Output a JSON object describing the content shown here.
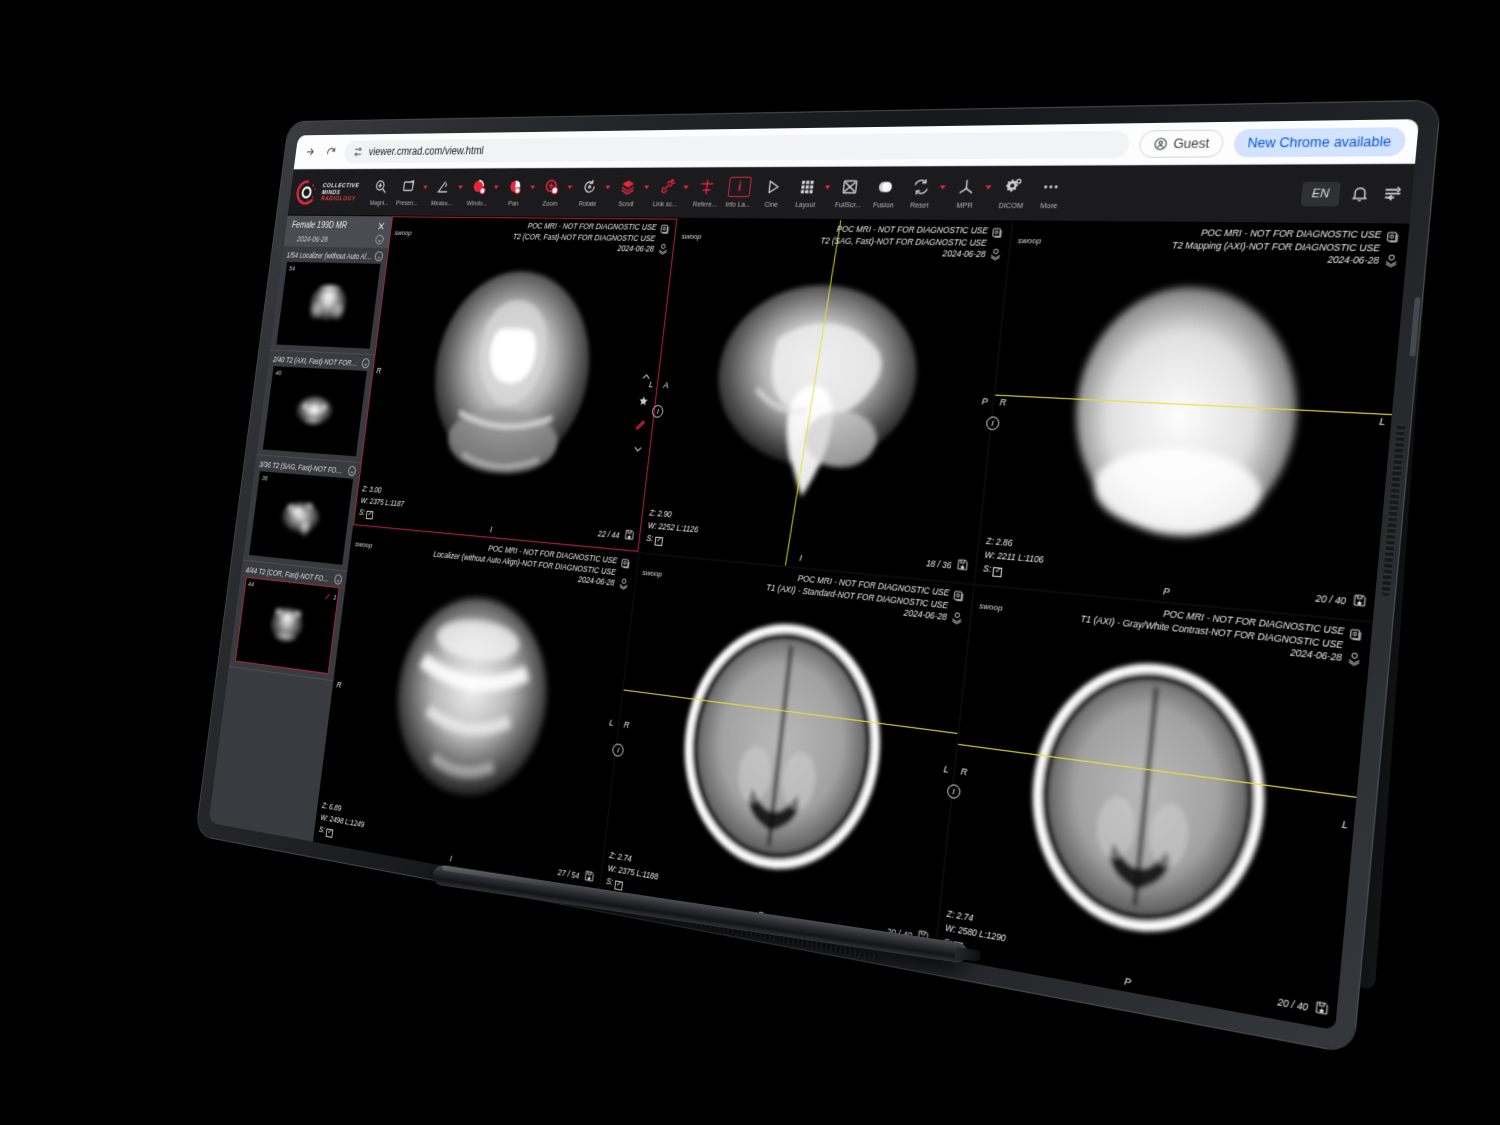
{
  "browser": {
    "url": "viewer.cmrad.com/view.html",
    "guest_label": "Guest",
    "update_banner": "New Chrome available",
    "forward_icon": "forward-arrow-icon",
    "reload_icon": "reload-icon",
    "tune_icon": "site-settings-icon"
  },
  "brand": {
    "line1": "COLLECTIVE",
    "line2": "MINDS",
    "line3": "RADIOLOGY"
  },
  "toolbar": {
    "tools": [
      {
        "label": "Magni...",
        "icon": "magnify-icon",
        "accent": false,
        "caret": false,
        "boxed": false
      },
      {
        "label": "Presen...",
        "icon": "presentation-icon",
        "accent": false,
        "caret": true,
        "boxed": false
      },
      {
        "label": "Measu...",
        "icon": "measure-angle-icon",
        "accent": false,
        "caret": true,
        "boxed": false
      },
      {
        "label": "Windo...",
        "icon": "window-level-icon",
        "accent": true,
        "caret": true,
        "boxed": false
      },
      {
        "label": "Pan",
        "icon": "pan-icon",
        "accent": true,
        "caret": true,
        "boxed": false
      },
      {
        "label": "Zoom",
        "icon": "zoom-icon",
        "accent": true,
        "caret": true,
        "boxed": false
      },
      {
        "label": "Rotate",
        "icon": "rotate-icon",
        "accent": false,
        "caret": true,
        "boxed": false
      },
      {
        "label": "Scroll",
        "icon": "scroll-stack-icon",
        "accent": true,
        "caret": true,
        "boxed": false
      },
      {
        "label": "Link sc...",
        "icon": "link-scroll-icon",
        "accent": true,
        "caret": true,
        "boxed": false
      },
      {
        "label": "Refere...",
        "icon": "reference-lines-icon",
        "accent": true,
        "caret": false,
        "boxed": false
      },
      {
        "label": "Info La...",
        "icon": "info-layer-icon",
        "accent": true,
        "caret": false,
        "boxed": true
      },
      {
        "label": "Cine",
        "icon": "play-cine-icon",
        "accent": false,
        "caret": false,
        "boxed": false
      },
      {
        "label": "Layout",
        "icon": "layout-grid-icon",
        "accent": false,
        "caret": true,
        "boxed": false
      },
      {
        "label": "FullScr...",
        "icon": "fullscreen-icon",
        "accent": false,
        "caret": false,
        "boxed": false
      },
      {
        "label": "Fusion",
        "icon": "fusion-icon",
        "accent": false,
        "caret": false,
        "boxed": false
      },
      {
        "label": "Reset",
        "icon": "reset-icon",
        "accent": false,
        "caret": true,
        "boxed": false
      },
      {
        "label": "MPR",
        "icon": "mpr-axes-icon",
        "accent": false,
        "caret": true,
        "boxed": false
      },
      {
        "label": "DICOM",
        "icon": "gear-dicom-icon",
        "accent": false,
        "caret": false,
        "boxed": false
      },
      {
        "label": "More",
        "icon": "more-dots-icon",
        "accent": false,
        "caret": false,
        "boxed": false
      }
    ],
    "language": "EN",
    "bell_icon": "notification-bell-icon",
    "settings_icon": "sliders-icon"
  },
  "sidebar": {
    "study_title": "Female 199D MR",
    "study_date": "2024-06-28",
    "close_icon": "close-icon",
    "info_icon": "info-icon",
    "series": [
      {
        "label": "1/54 Localizer (without Auto Alig...",
        "count": "54",
        "active": false,
        "annotations": null
      },
      {
        "label": "2/40 T2 (AXI, Fast)-NOT FOR DIA...",
        "count": "40",
        "active": false,
        "annotations": null
      },
      {
        "label": "3/36 T2 (SAG, Fast)-NOT FOR DIA...",
        "count": "36",
        "active": false,
        "annotations": null
      },
      {
        "label": "4/44 T2 (COR, Fast)-NOT FOR DI...",
        "count": "44",
        "active": true,
        "annotations": "1"
      }
    ]
  },
  "viewports": [
    {
      "source": "swoop",
      "line1": "POC MRI - NOT FOR DIAGNOSTIC USE",
      "line2": "T2 (COR, Fast)-NOT FOR DIAGNOSTIC USE",
      "date": "2024-06-28",
      "zoom": "Z: 3.00",
      "wl": "W: 2375 L:1187",
      "s_label": "S:",
      "count": "22 / 44",
      "orient_left": "R",
      "orient_right": "L",
      "orient_bottom": "I",
      "orient_top": "",
      "active": true
    },
    {
      "source": "swoop",
      "line1": "POC MRI - NOT FOR DIAGNOSTIC USE",
      "line2": "T2 (SAG, Fast)-NOT FOR DIAGNOSTIC USE",
      "date": "2024-06-28",
      "zoom": "Z: 2.90",
      "wl": "W: 2252 L:1126",
      "s_label": "S:",
      "count": "18 / 36",
      "orient_left": "A",
      "orient_right": "P",
      "orient_bottom": "I",
      "orient_top": "",
      "active": false
    },
    {
      "source": "swoop",
      "line1": "POC MRI - NOT FOR DIAGNOSTIC USE",
      "line2": "T2 Mapping (AXI)-NOT FOR DIAGNOSTIC USE",
      "date": "2024-06-28",
      "zoom": "Z: 2.86",
      "wl": "W: 2211 L:1106",
      "s_label": "S:",
      "count": "20 / 40",
      "orient_left": "R",
      "orient_right": "L",
      "orient_bottom": "P",
      "orient_top": "",
      "active": false
    },
    {
      "source": "swoop",
      "line1": "POC MRI - NOT FOR DIAGNOSTIC USE",
      "line2": "Localizer (without Auto Align)-NOT FOR DIAGNOSTIC USE",
      "date": "2024-06-28",
      "zoom": "Z: 6.89",
      "wl": "W: 2498 L:1249",
      "s_label": "S:",
      "count": "27 / 54",
      "orient_left": "R",
      "orient_right": "L",
      "orient_bottom": "I",
      "orient_top": "",
      "active": false
    },
    {
      "source": "swoop",
      "line1": "POC MRI - NOT FOR DIAGNOSTIC USE",
      "line2": "T1 (AXI) - Standard-NOT FOR DIAGNOSTIC USE",
      "date": "2024-06-28",
      "zoom": "Z: 2.74",
      "wl": "W: 2375 L:1188",
      "s_label": "S:",
      "count": "20 / 40",
      "orient_left": "R",
      "orient_right": "L",
      "orient_bottom": "P",
      "orient_top": "",
      "active": false
    },
    {
      "source": "swoop",
      "line1": "POC MRI - NOT FOR DIAGNOSTIC USE",
      "line2": "T1 (AXI) - Gray/White Contrast-NOT FOR DIAGNOSTIC USE",
      "date": "2024-06-28",
      "zoom": "Z: 2.74",
      "wl": "W: 2580 L:1290",
      "s_label": "S:",
      "count": "20 / 40",
      "orient_left": "R",
      "orient_right": "L",
      "orient_bottom": "P",
      "orient_top": "",
      "active": false
    }
  ],
  "colors": {
    "accent_red": "#e8253b",
    "active_border": "#c2223c",
    "crosshair_yellow": "#e9e12e",
    "toolbar_bg": "#1b1b1d",
    "sidebar_bg": "#3a3b41"
  }
}
